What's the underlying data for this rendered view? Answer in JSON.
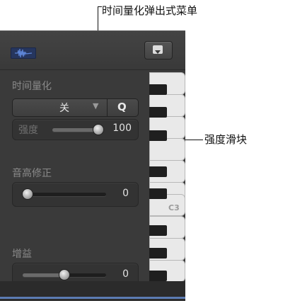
{
  "callouts": {
    "top": "时间量化弹出式菜单",
    "right": "强度滑块"
  },
  "time_quantize": {
    "label": "时间量化",
    "popup_value": "关",
    "q_button": "Q",
    "strength": {
      "label": "强度",
      "value": "100",
      "level": 1.0
    }
  },
  "pitch_correction": {
    "label": "音高修正",
    "value": "0",
    "level": 0.0
  },
  "gain": {
    "label": "增益",
    "value": "0",
    "level": 0.5
  },
  "keyboard": {
    "c_label": "C3"
  },
  "icons": [
    "waveform-icon",
    "popup-menu-icon",
    "popup-arrow-icon"
  ],
  "colors": {
    "panel": "#3a3a3a",
    "accent_blue": "#5b7bb3",
    "key_white": "#e9e9e9",
    "key_black": "#1f1f1f"
  }
}
